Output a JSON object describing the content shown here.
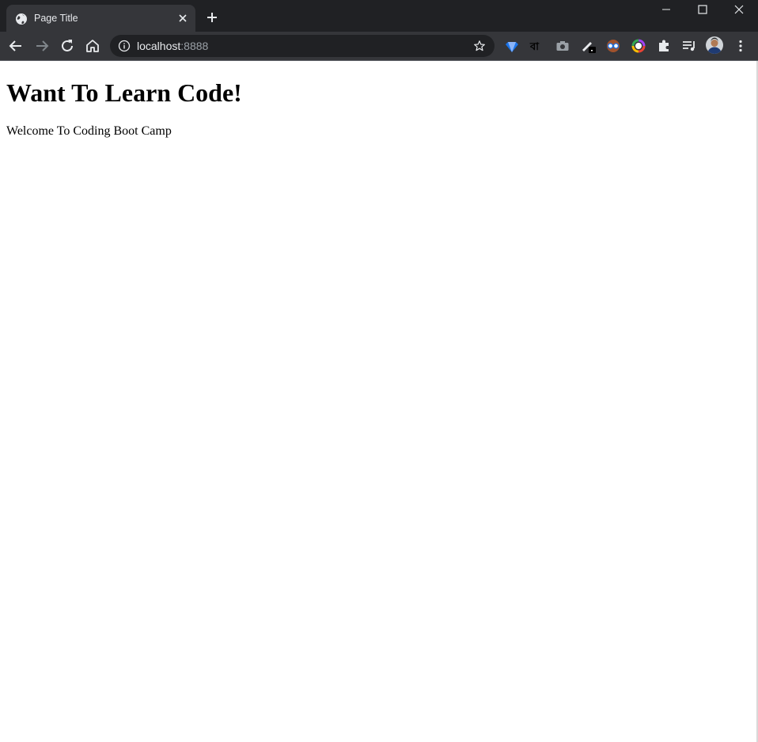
{
  "browser": {
    "tab": {
      "title": "Page Title",
      "favicon": "globe-icon"
    },
    "new_tab_icon": "plus-icon",
    "window_controls": [
      "minimize-icon",
      "maximize-icon",
      "close-icon"
    ],
    "toolbar": {
      "nav_icons": [
        "back-arrow-icon",
        "forward-arrow-icon",
        "reload-icon",
        "home-icon"
      ],
      "address": {
        "host": "localhost",
        "port": ":8888",
        "info_icon": "info-icon",
        "bookmark_icon": "star-icon"
      },
      "extensions": [
        "gem-extension-icon",
        "bengali-text-extension-icon",
        "camera-extension-icon",
        "pen-extension-icon",
        "glasses-extension-icon",
        "color-ring-extension-icon",
        "puzzle-icon",
        "reading-list-icon",
        "profile-avatar",
        "kebab-menu-icon"
      ],
      "bengali_extension_glyph": "বা"
    }
  },
  "page": {
    "heading": "Want To Learn Code!",
    "paragraph": "Welcome To Coding Boot Camp"
  },
  "colors": {
    "titlebar": "#202124",
    "tab_active": "#35363a",
    "toolbar": "#35363a",
    "omnibox": "#202124",
    "page_background": "#ffffff"
  }
}
